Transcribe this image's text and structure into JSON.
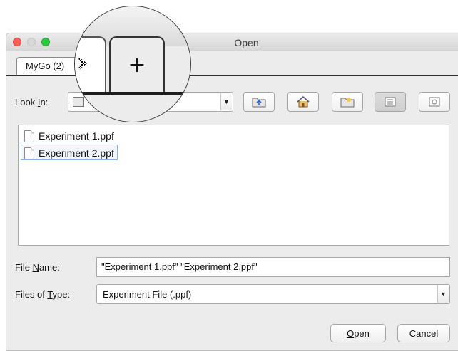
{
  "window": {
    "title": "Open"
  },
  "tabs": [
    {
      "label": "MyGo (2)"
    }
  ],
  "new_tab": {
    "label": "+"
  },
  "look_in": {
    "label_prefix": "Look ",
    "label_mnemonic": "I",
    "label_suffix": "n:",
    "value": ""
  },
  "toolbar": {
    "icons": [
      "up-folder-icon",
      "home-icon",
      "new-folder-icon",
      "list-view-icon",
      "details-view-icon"
    ]
  },
  "files": [
    {
      "name": "Experiment 1.ppf",
      "selected": false
    },
    {
      "name": "Experiment 2.ppf",
      "selected": true
    }
  ],
  "file_name": {
    "label_prefix": "File ",
    "label_mnemonic": "N",
    "label_suffix": "ame:",
    "value": "\"Experiment 1.ppf\" \"Experiment 2.ppf\""
  },
  "file_type": {
    "label_prefix": "Files of ",
    "label_mnemonic": "T",
    "label_suffix": "ype:",
    "value": "Experiment File (.ppf)"
  },
  "buttons": {
    "open": {
      "mnemonic": "O",
      "rest": "pen"
    },
    "cancel": {
      "label": "Cancel"
    }
  }
}
